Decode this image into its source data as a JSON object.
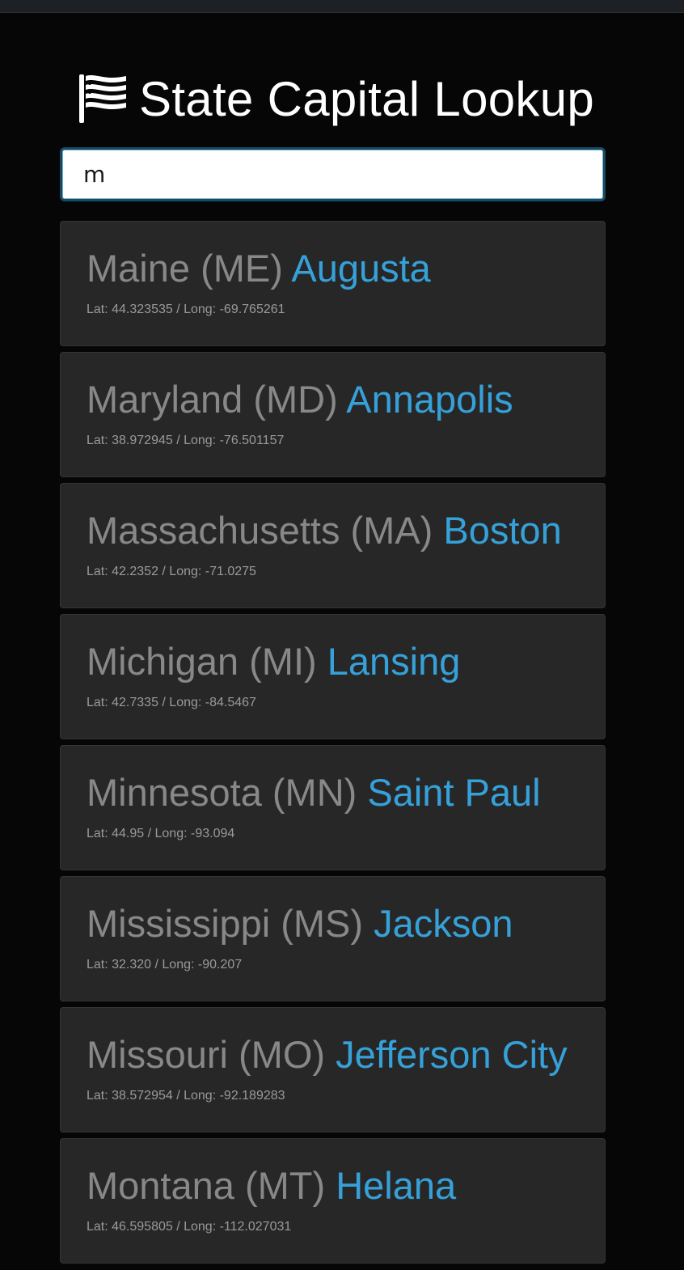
{
  "app": {
    "title": "State Capital Lookup",
    "icon": "flag-icon"
  },
  "search": {
    "value": "m",
    "placeholder": ""
  },
  "colors": {
    "background": "#060606",
    "card": "#272727",
    "state_text": "#888888",
    "capital_text": "#36a1d9",
    "coords_text": "#9a9a9a"
  },
  "results": [
    {
      "state": "Maine (ME)",
      "capital": "Augusta",
      "coords": "Lat: 44.323535 / Long: -69.765261"
    },
    {
      "state": "Maryland (MD)",
      "capital": "Annapolis",
      "coords": "Lat: 38.972945 / Long: -76.501157"
    },
    {
      "state": "Massachusetts (MA)",
      "capital": "Boston",
      "coords": "Lat: 42.2352 / Long: -71.0275"
    },
    {
      "state": "Michigan (MI)",
      "capital": "Lansing",
      "coords": "Lat: 42.7335 / Long: -84.5467"
    },
    {
      "state": "Minnesota (MN)",
      "capital": "Saint Paul",
      "coords": "Lat: 44.95 / Long: -93.094"
    },
    {
      "state": "Mississippi (MS)",
      "capital": "Jackson",
      "coords": "Lat: 32.320 / Long: -90.207"
    },
    {
      "state": "Missouri (MO)",
      "capital": "Jefferson City",
      "coords": "Lat: 38.572954 / Long: -92.189283"
    },
    {
      "state": "Montana (MT)",
      "capital": "Helana",
      "coords": "Lat: 46.595805 / Long: -112.027031"
    }
  ]
}
